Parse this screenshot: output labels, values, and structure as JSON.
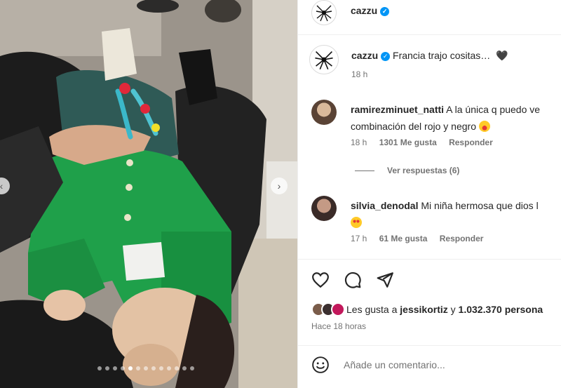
{
  "post": {
    "author": "cazzu",
    "caption_text": "Francia trajo cositas…",
    "caption_emoji": "🖤",
    "caption_time": "18 h"
  },
  "comments": [
    {
      "username": "ramirezminuet_natti",
      "text": "A la única q puedo ve",
      "text_line2": "combinación del rojo y negro",
      "time": "18 h",
      "likes": "1301 Me gusta",
      "reply": "Responder",
      "avatar_color": "#a88a6a"
    },
    {
      "username": "silvia_denodal",
      "text": "Mi niña hermosa que dios l",
      "time": "17 h",
      "likes": "61 Me gusta",
      "reply": "Responder",
      "avatar_color": "#6e5a55"
    }
  ],
  "view_replies": "Ver respuestas (6)",
  "likes": {
    "prefix": "Les gusta a ",
    "user": "jessikortiz",
    "middle": " y ",
    "count": "1.032.370 persona",
    "liker_colors": [
      "#7a5c4a",
      "#3b2f2f",
      "#c2185b"
    ]
  },
  "posted_ago": "Hace 18 horas",
  "comment_input": {
    "placeholder": "Añade un comentario..."
  },
  "carousel": {
    "total": 13,
    "active_index": 4
  },
  "icons": {
    "like": "heart-outline-icon",
    "comment": "comment-bubble-icon",
    "share": "paper-plane-icon",
    "emoji": "smiley-icon",
    "verified": "verified-badge-icon"
  },
  "colors": {
    "verified_blue": "#0095f6",
    "text": "#262626",
    "secondary_text": "#737373",
    "sweater_green": "#1fa04a"
  }
}
